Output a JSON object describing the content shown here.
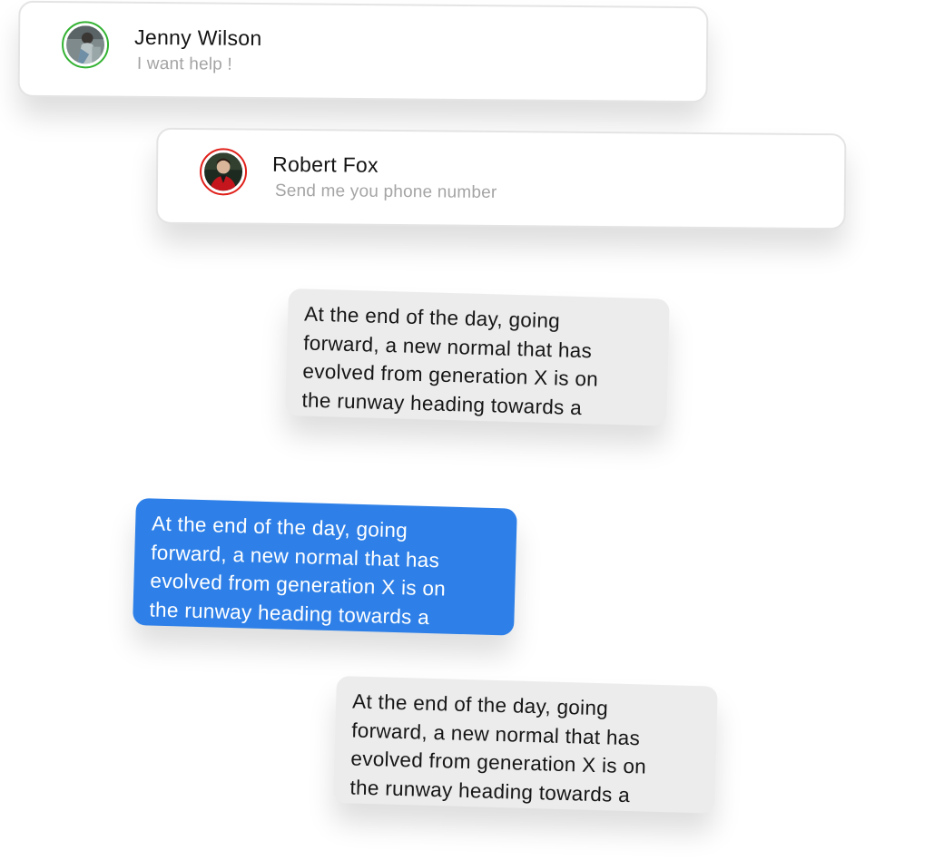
{
  "conversations": [
    {
      "name": "Jenny Wilson",
      "preview": "I want help !",
      "avatar_ring_color": "#34b233"
    },
    {
      "name": "Robert Fox",
      "preview": "Send me you phone number",
      "avatar_ring_color": "#e0201a"
    }
  ],
  "messages": [
    {
      "type": "received",
      "color": "#ececec",
      "lines": [
        "At the end of the day, going",
        "forward, a new normal that has",
        "evolved from generation X is on",
        "the runway heading towards a"
      ]
    },
    {
      "type": "sent",
      "color": "#2e80e8",
      "lines": [
        "At the end of the day, going",
        "forward, a new normal that has",
        "evolved from generation X is on",
        "the runway heading towards a"
      ]
    },
    {
      "type": "received",
      "color": "#ececec",
      "lines": [
        "At the end of the day, going",
        "forward, a new normal that has",
        "evolved from generation X is on",
        "the runway heading towards a"
      ]
    }
  ]
}
